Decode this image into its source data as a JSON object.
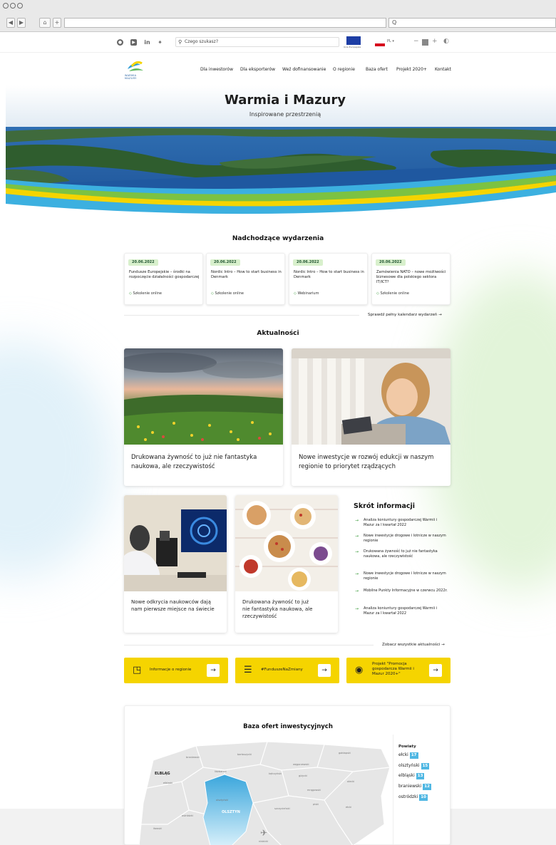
{
  "browser": {
    "add_tab": "+",
    "search_glyph": "Q"
  },
  "topbar": {
    "search_placeholder": "Czego szukasz?",
    "eu_label": "Unia Europejska",
    "lang": "PL"
  },
  "nav": {
    "items": [
      "Dla inwestorów",
      "Dla eksporterów",
      "Weź dofinansowanie",
      "O regionie",
      "Baza ofert",
      "Projekt 2020+",
      "Kontakt"
    ],
    "logo_text": "WARMIA MAZURY"
  },
  "hero": {
    "title": "Warmia i Mazury",
    "subtitle": "Inspirowane przestrzenią"
  },
  "events": {
    "title": "Nadchodzące wydarzenia",
    "items": [
      {
        "date": "20.06.2022",
        "title": "Fundusze Europejskie – środki na rozpoczęcie działalności gospodarczej",
        "tag": "Szkolenie online"
      },
      {
        "date": "20.06.2022",
        "title": "Nordic Intro – How to start business in Denmark",
        "tag": "Szkolenie online"
      },
      {
        "date": "20.06.2022",
        "title": "Nordic Intro – How to start business in Denmark",
        "tag": "Webinarium"
      },
      {
        "date": "20.06.2022",
        "title": "Zamówienia NATO – nowe możliwości biznesowe dla polskiego sektora IT/ICT?",
        "tag": "Szkolenie online"
      }
    ],
    "calendar_link": "Sprawdź pełny kalendarz wydarzeń →"
  },
  "news": {
    "title": "Aktualności",
    "big": [
      {
        "title": "Drukowana żywność to już nie fantastyka naukowa, ale rzeczywistość"
      },
      {
        "title": "Nowe inwestycje w rozwój edukcji w naszym regionie to priorytet rządzących"
      }
    ],
    "small": [
      {
        "title": "Nowe odkrycia naukowców dają nam pierwsze miejsce na świecie"
      },
      {
        "title": "Drukowana żywność to już nie fantastyka naukowa, ale rzeczywistość"
      }
    ],
    "all_link": "Zobacz wszystkie aktualności →"
  },
  "short": {
    "title": "Skrót informacji",
    "items": [
      "Analiza koniuntury gospodarczej Warmii i Mazur za I kwartał 2022",
      "Nowe inwestycje drogowe i lotnicze w naszym regionie",
      "Drukowana żywność to już nie fantastyka naukowa, ale rzeczywistość",
      "Nowe inwestycje drogowe i lotnicze w naszym regionie",
      "Mobilne Punkty Informacyjne w czerwcu 2022r.",
      "Analiza koniuntury gospodarczej Warmii i Mazur za I kwartał 2022"
    ]
  },
  "ctas": [
    {
      "label": "Informacje o regionie"
    },
    {
      "label": "#FunduszeNaZmiany"
    },
    {
      "label": "Projekt \"Promocja gospodarcza Warmii i Mazur 2020+\""
    }
  ],
  "map": {
    "title": "Baza ofert inwestycyjnych",
    "legend_title": "Powiaty",
    "legend": [
      {
        "name": "ełcki",
        "count": "17"
      },
      {
        "name": "olsztyński",
        "count": "15"
      },
      {
        "name": "elbląski",
        "count": "13"
      },
      {
        "name": "braniewski",
        "count": "12"
      },
      {
        "name": "ostródzki",
        "count": "10"
      }
    ],
    "cities": {
      "elblag": "ELBLĄG",
      "olsztyn": "OLSZTYN"
    },
    "counties": [
      "braniewski",
      "bartoszycki",
      "węgorzewski",
      "gołdapski",
      "lidzbarski",
      "kętrzyński",
      "giżycki",
      "olecki",
      "elbląski",
      "ełcki",
      "piski",
      "mrągowski",
      "ostródzki",
      "olsztyński",
      "szczycieński",
      "nidzicki",
      "iławski"
    ]
  },
  "colors": {
    "yellow": "#f5d400",
    "green": "#3a9a3a",
    "map_blue": "#4fb7e3"
  }
}
